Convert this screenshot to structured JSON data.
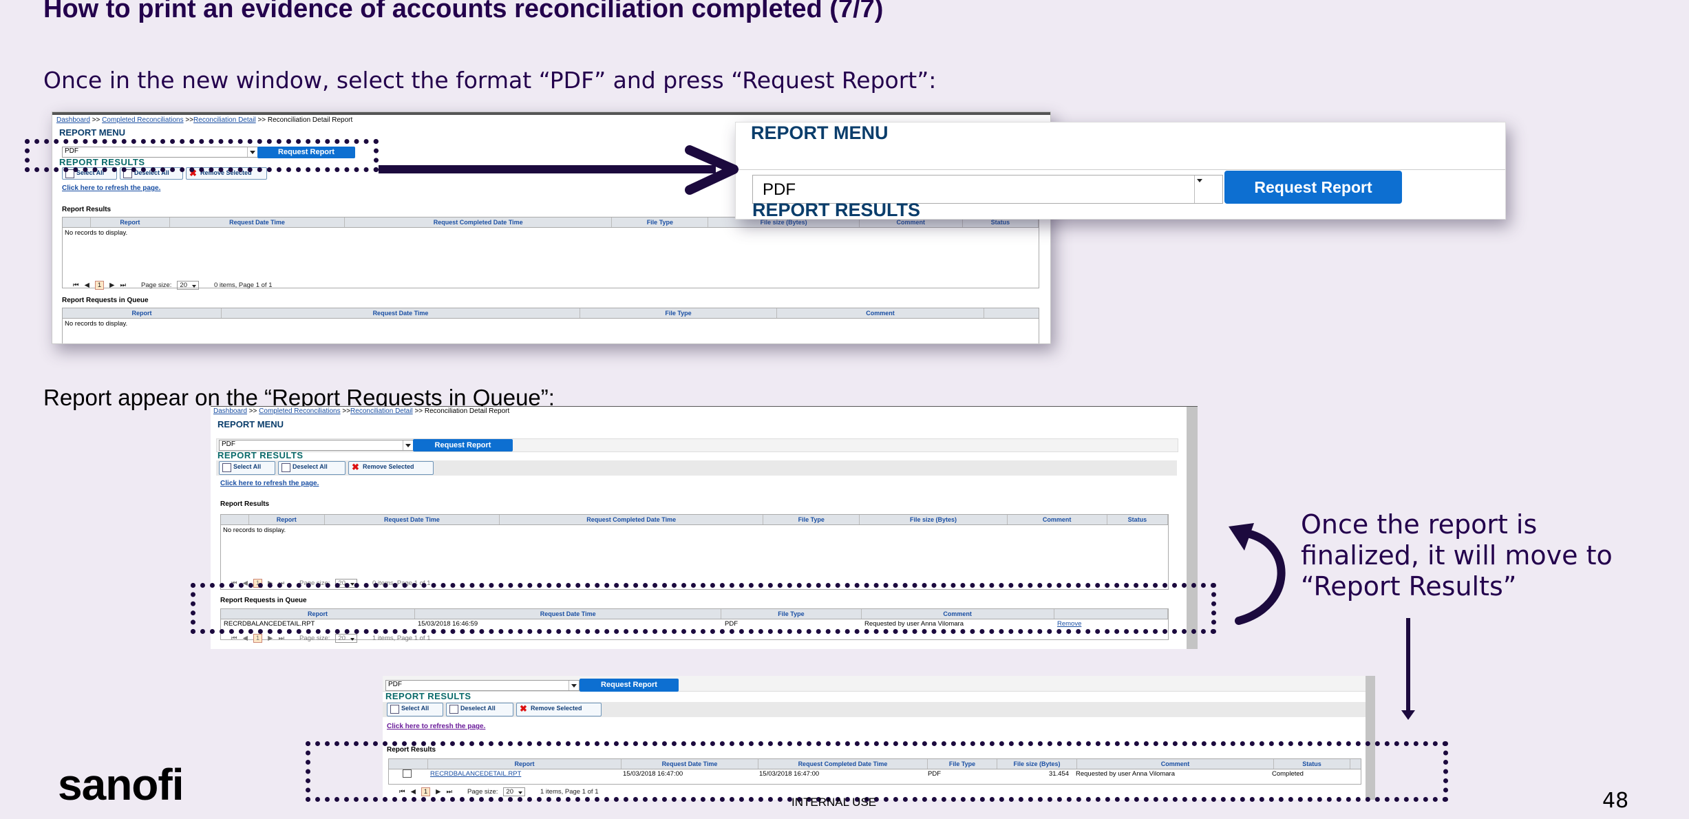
{
  "slide": {
    "title": "How to print an evidence of accounts reconciliation completed (7/7)",
    "instruction_1": "Once in the new window, select the format “PDF” and press “Request Report”:",
    "instruction_2": "Report appear on the “Report Requests in Queue”:",
    "callout": [
      "Once the report is",
      "finalized, it will move to",
      "“Report Results”"
    ],
    "footer_classification": "INTERNAL USE",
    "page_number": "48",
    "logo_text": "sanofi",
    "colors": {
      "background": "#efeaf3",
      "brand_dark": "#23004c",
      "button_blue": "#0d6fd1"
    }
  },
  "app": {
    "breadcrumb": {
      "dashboard": "Dashboard",
      "sep": ">>",
      "completed": "Completed Reconciliations",
      "detail": "Reconciliation Detail",
      "current": ">> Reconciliation Detail Report"
    },
    "report_menu": "REPORT MENU",
    "report_results": "REPORT RESULTS",
    "format_value": "PDF",
    "request_button": "Request Report",
    "select_all": "Select All",
    "deselect_all": "Deselect All",
    "remove_selected": "Remove Selected",
    "refresh_link": "Click here to refresh the page.",
    "section_results": "Report Results",
    "section_queue": "Report Requests in Queue",
    "results_headers": [
      "Report",
      "Request Date Time",
      "Request Completed Date Time",
      "File Type",
      "File size (Bytes)",
      "Comment",
      "Status"
    ],
    "queue_headers": [
      "Report",
      "Request Date Time",
      "File Type",
      "Comment"
    ],
    "no_records": "No records to display.",
    "page_size_label": "Page size:",
    "page_size_value": "20",
    "page_current": "1",
    "pager_empty": "0 items, Page 1 of 1",
    "pager_one": "1 items, Page 1 of 1",
    "queue_row": {
      "report": "RECRDBALANCEDETAIL.RPT",
      "request_dt": "15/03/2018 16:46:59",
      "file_type": "PDF",
      "comment": "Requested by user Anna Vilomara",
      "action": "Remove"
    },
    "result_row": {
      "report": "RECRDBALANCEDETAIL.RPT",
      "request_dt": "15/03/2018 16:47:00",
      "completed_dt": "15/03/2018 16:47:00",
      "file_type": "PDF",
      "file_size": "31.454",
      "comment": "Requested by user Anna Vilomara",
      "status": "Completed"
    }
  }
}
